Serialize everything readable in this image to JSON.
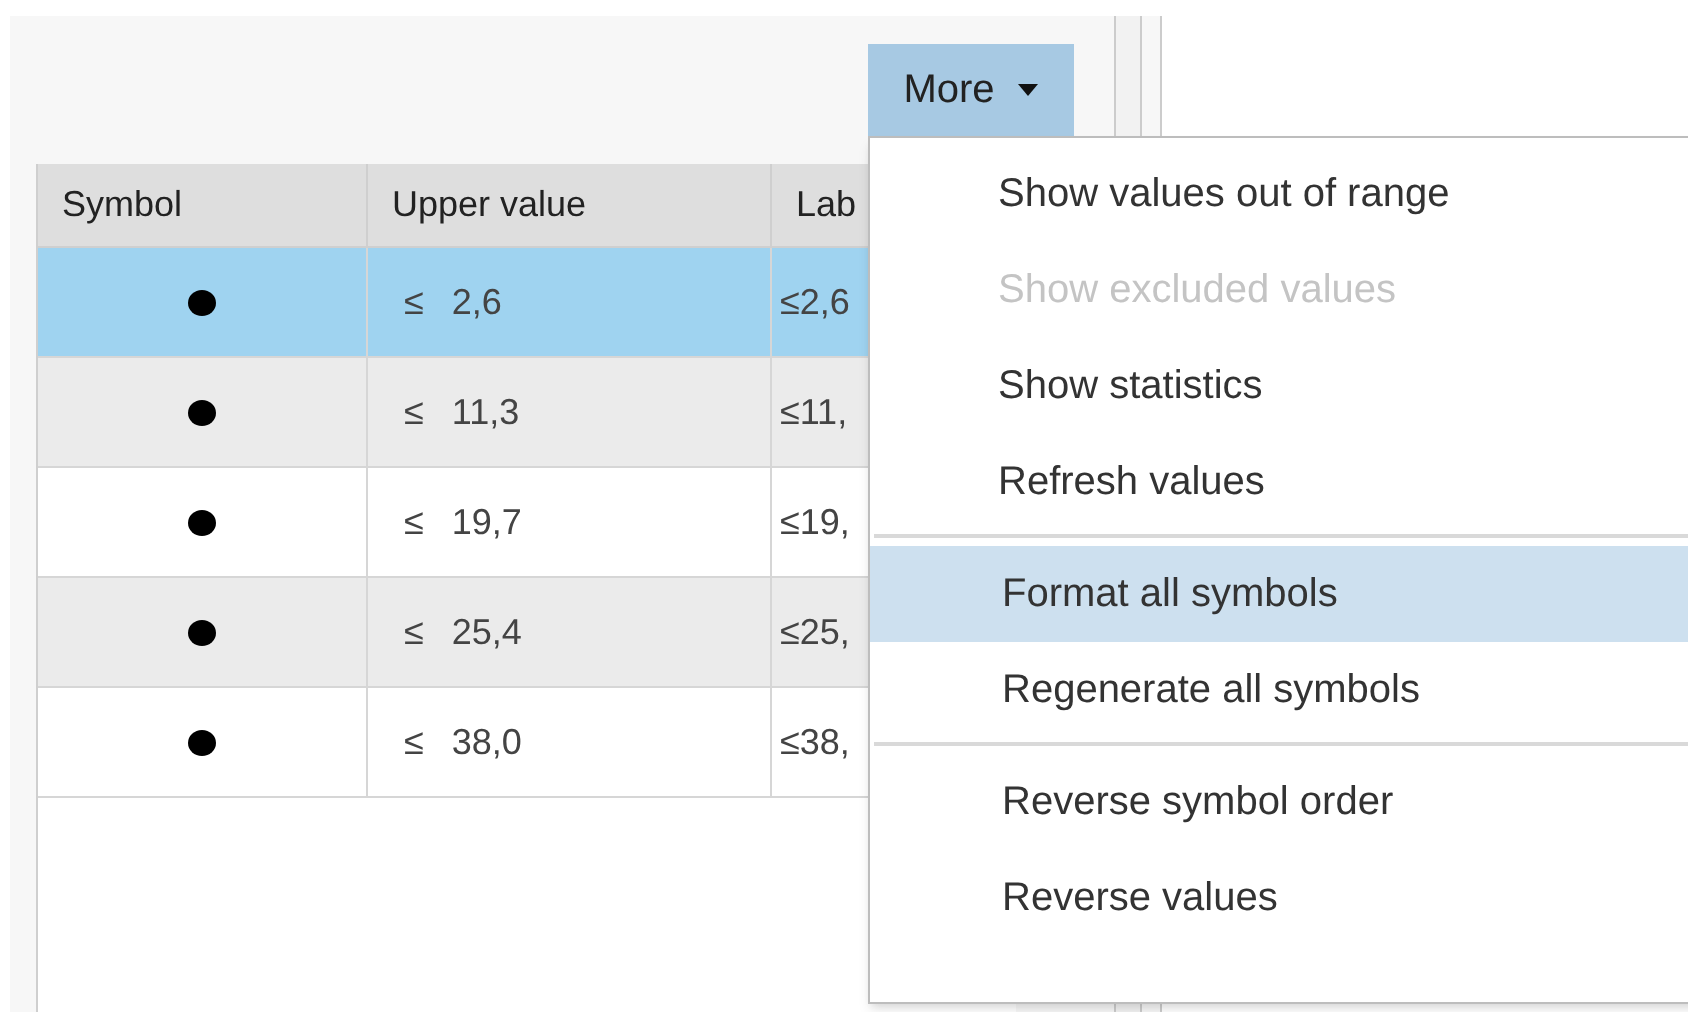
{
  "more_button": {
    "label": "More",
    "expanded": true
  },
  "table": {
    "columns": [
      "Symbol",
      "Upper value",
      "Lab"
    ],
    "rows": [
      {
        "operator": "≤",
        "upper": "2,6",
        "label": "≤2,6",
        "selected": true
      },
      {
        "operator": "≤",
        "upper": "11,3",
        "label": "≤11,",
        "selected": false
      },
      {
        "operator": "≤",
        "upper": "19,7",
        "label": "≤19,",
        "selected": false
      },
      {
        "operator": "≤",
        "upper": "25,4",
        "label": "≤25,",
        "selected": false
      },
      {
        "operator": "≤",
        "upper": "38,0",
        "label": "≤38,",
        "selected": false
      }
    ]
  },
  "menu": {
    "groups": [
      [
        {
          "label": "Show values out of range",
          "disabled": false,
          "selected": false
        },
        {
          "label": "Show excluded values",
          "disabled": true,
          "selected": false
        },
        {
          "label": "Show statistics",
          "disabled": false,
          "selected": false
        },
        {
          "label": "Refresh values",
          "disabled": false,
          "selected": false
        }
      ],
      [
        {
          "label": "Format all symbols",
          "disabled": false,
          "selected": true
        },
        {
          "label": "Regenerate all symbols",
          "disabled": false,
          "selected": false
        }
      ],
      [
        {
          "label": "Reverse symbol order",
          "disabled": false,
          "selected": false
        },
        {
          "label": "Reverse values",
          "disabled": false,
          "selected": false
        }
      ]
    ]
  }
}
